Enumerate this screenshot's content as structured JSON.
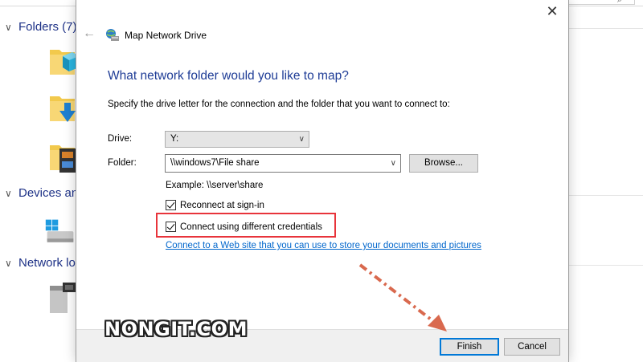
{
  "explorer": {
    "groups": [
      {
        "label": "Folders (7)"
      },
      {
        "label": "Devices an"
      },
      {
        "label": "Network lo"
      }
    ]
  },
  "dialog": {
    "title": "Map Network Drive",
    "heading": "What network folder would you like to map?",
    "description": "Specify the drive letter for the connection and the folder that you want to connect to:",
    "drive_label": "Drive:",
    "drive_value": "Y:",
    "folder_label": "Folder:",
    "folder_value": "\\\\windows7\\File share",
    "browse_label": "Browse...",
    "example": "Example: \\\\server\\share",
    "reconnect_label": "Reconnect at sign-in",
    "reconnect_checked": true,
    "credentials_label": "Connect using different credentials",
    "credentials_checked": true,
    "link_text": "Connect to a Web site that you can use to store your documents and pictures",
    "finish_label": "Finish",
    "cancel_label": "Cancel",
    "close_icon": "close-icon",
    "back_icon": "back-arrow-icon"
  },
  "annotations": {
    "watermark": "NONGIT.COM",
    "highlight_color": "#e8343b",
    "arrow_color": "#d9694e"
  }
}
